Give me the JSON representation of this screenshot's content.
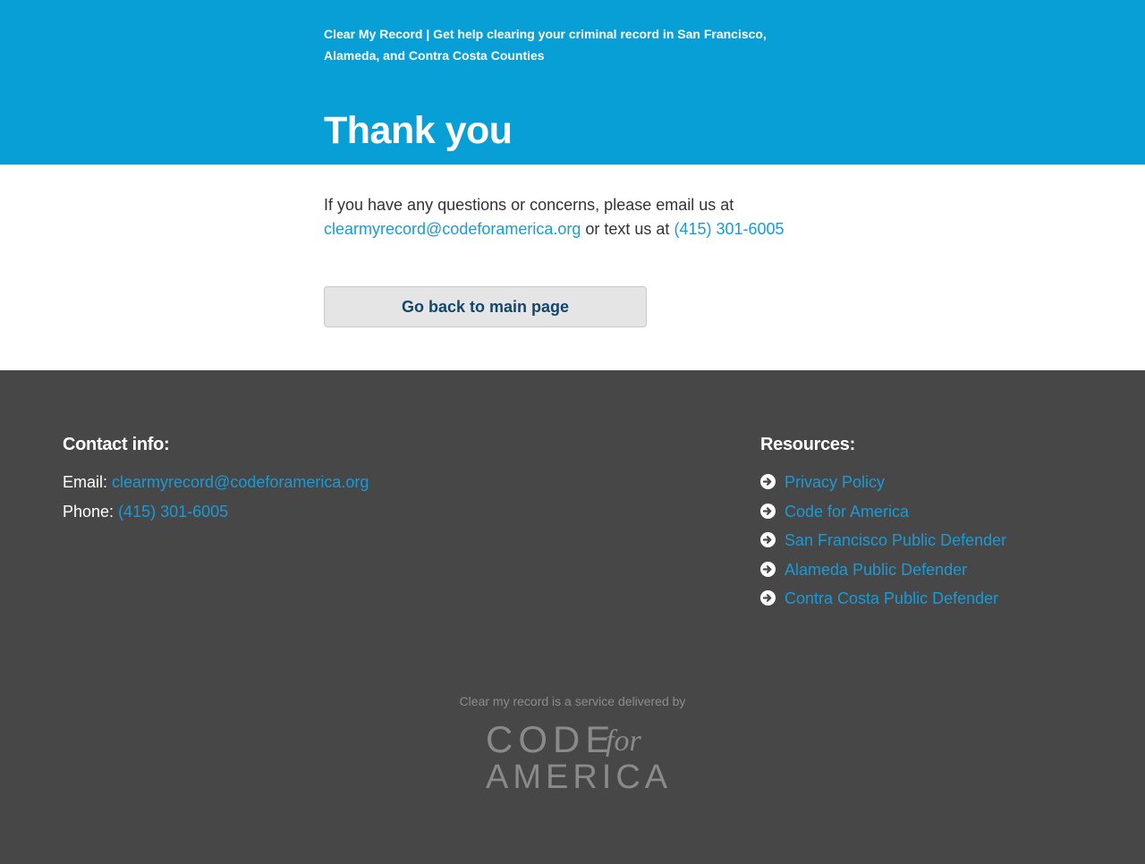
{
  "header": {
    "tagline": "Clear My Record | Get help clearing your criminal record in San Francisco, Alameda, and Contra Costa Counties",
    "title": "Thank you",
    "background_color": "#079fd6"
  },
  "main": {
    "message_before": "If you have any questions or concerns, please email us at ",
    "email": "clearmyrecord@codeforamerica.org",
    "message_middle": " or text us at ",
    "phone": "(415) 301-6005",
    "back_button_label": "Go back to main page"
  },
  "footer": {
    "background_color": "#474747",
    "link_color": "#1a9ad6",
    "contact": {
      "heading": "Contact info:",
      "email_label": "Email: ",
      "email": "clearmyrecord@codeforamerica.org",
      "phone_label": "Phone: ",
      "phone": "(415) 301-6005"
    },
    "resources": {
      "heading": "Resources:",
      "icon": "arrow-right-circle-icon",
      "items": [
        {
          "label": "Privacy Policy"
        },
        {
          "label": "Code for America"
        },
        {
          "label": "San Francisco Public Defender"
        },
        {
          "label": "Alameda Public Defender"
        },
        {
          "label": "Contra Costa Public Defender"
        }
      ]
    },
    "credit": "Clear my record is a service delivered by",
    "logo": {
      "line1": "CODE",
      "for": "for",
      "line2": "AMERICA"
    }
  }
}
